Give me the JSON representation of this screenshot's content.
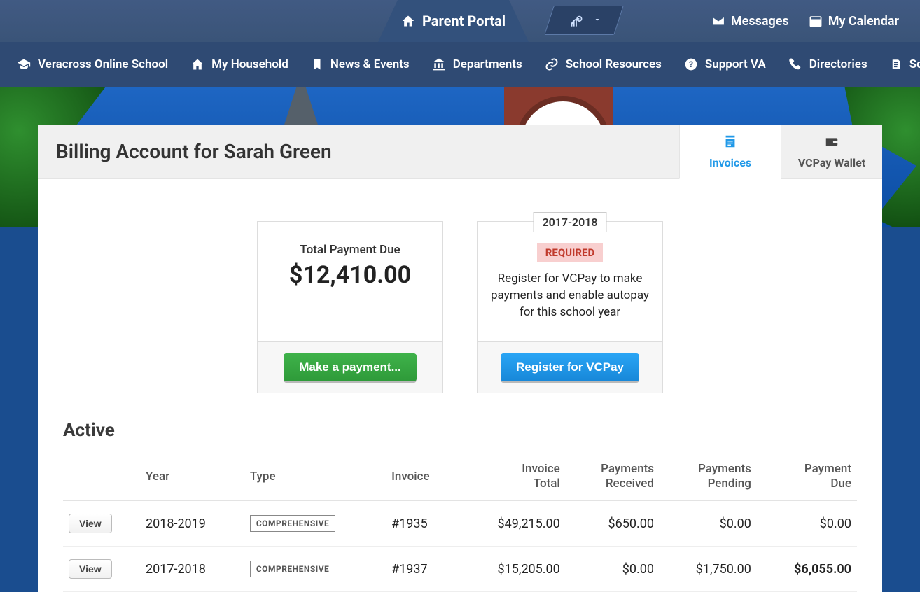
{
  "header": {
    "portal_label": "Parent Portal",
    "messages": "Messages",
    "calendar": "My Calendar"
  },
  "nav": {
    "items": [
      "Veracross Online School",
      "My Household",
      "News & Events",
      "Departments",
      "School Resources",
      "Support VA",
      "Directories",
      "School Programs"
    ]
  },
  "page": {
    "title": "Billing Account for Sarah Green",
    "tabs": {
      "invoices": "Invoices",
      "wallet": "VCPay Wallet"
    }
  },
  "payment_card": {
    "label": "Total Payment Due",
    "amount": "$12,410.00",
    "button": "Make a payment..."
  },
  "register_card": {
    "year_tag": "2017-2018",
    "required": "REQUIRED",
    "text": "Register for VCPay to make payments and enable autopay for this school year",
    "button": "Register for VCPay"
  },
  "invoices": {
    "section_title": "Active",
    "view_label": "View",
    "columns": {
      "year": "Year",
      "type": "Type",
      "invoice": "Invoice",
      "total": "Invoice Total",
      "received": "Payments Received",
      "pending": "Payments Pending",
      "due": "Payment Due"
    },
    "rows": [
      {
        "year": "2018-2019",
        "type": "COMPREHENSIVE",
        "invoice": "#1935",
        "total": "$49,215.00",
        "received": "$650.00",
        "pending": "$0.00",
        "due": "$0.00",
        "received_muted": false,
        "pending_muted": true,
        "due_muted": true,
        "due_bold": false
      },
      {
        "year": "2017-2018",
        "type": "COMPREHENSIVE",
        "invoice": "#1937",
        "total": "$15,205.00",
        "received": "$0.00",
        "pending": "$1,750.00",
        "due": "$6,055.00",
        "received_muted": true,
        "pending_muted": false,
        "due_muted": false,
        "due_bold": true
      }
    ]
  }
}
